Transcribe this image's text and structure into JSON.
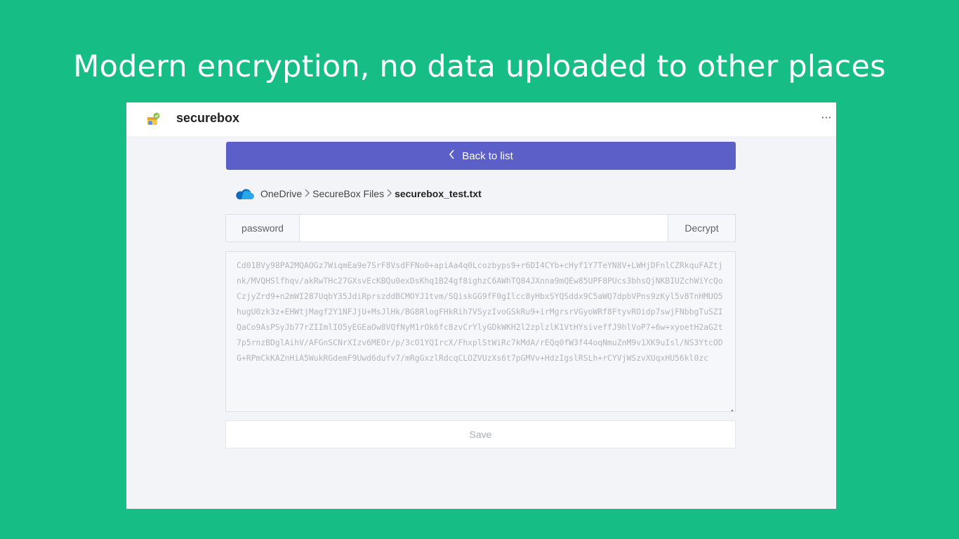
{
  "headline": "Modern encryption, no data uploaded to other places",
  "app": {
    "name": "securebox",
    "icon": "securebox-logo-icon",
    "more_label": "···"
  },
  "back_button": {
    "label": "Back to list",
    "icon": "chevron-left-icon"
  },
  "breadcrumb": {
    "icon": "onedrive-cloud-icon",
    "items": [
      "OneDrive",
      "SecureBox Files",
      "securebox_test.txt"
    ],
    "separator": ">"
  },
  "password": {
    "label": "password",
    "value": "",
    "placeholder": ""
  },
  "decrypt_button": {
    "label": "Decrypt"
  },
  "cipher_text": "Cd01BVy98PA2MQAOGz7WiqmEa9e7SrF8VsdFFNo0+apiAa4q0Lcozbyps9+r6DI4CYb+cHyf1Y7TeYN8V+LWHjDFnlCZRkquFAZtjnk/MVQHSlfhqv/akRwTHc27GXsvEcKBQu0exDsKhq1B24gf8ighzC6AWhTQ84JXnna9mQEw85UPF8PUcs3bhsQjNKBIUZchWiYcQoCzjyZrd9+n2mWI287UqbY35JdiRprszddBCMOYJ1tvm/SQiskGG9fF0gIlcc8yHbxSYQSddx9C5aWQ7dpbVPns9zKyl5v8TnHMUO5hugU0zk3z+EHWtjMagf2Y1NFJjU+MsJlHk/BG8RlogFHkRih7VSyzIvoGSkRu9+irMgrsrVGyoWRf8FtyvROidp7swjFNbbgTuSZIQaCo9AsPSyJb77rZIImlIO5yEGEaOw8VQfNyM1rOk6fc8zvCrYlyGDkWKH2l2zplzlK1VtHYsiveffJ9hlVoP7+6w+xyoetH2aG2t7p5rnzBDglAihV/AFGnSCNrXIzv6MEOr/p/3cO1YQIrcX/FhxplStWiRc7kMdA/rEQq0fW3f44oqNmuZnM9v1XK9uIsl/NS3YtcODG+RPmCkKAZnHiA5WukRGdemF9Uwd6dufv7/mRgGxzlRdcqCLOZVUzXs6t7pGMVv+HdzIgslRSLh+rCYVjWSzvXUqxHU56kl0zc",
  "save_button": {
    "label": "Save"
  },
  "colors": {
    "background": "#16bd85",
    "accent": "#5b5fc7",
    "onedrive": "#0f6cbd"
  }
}
